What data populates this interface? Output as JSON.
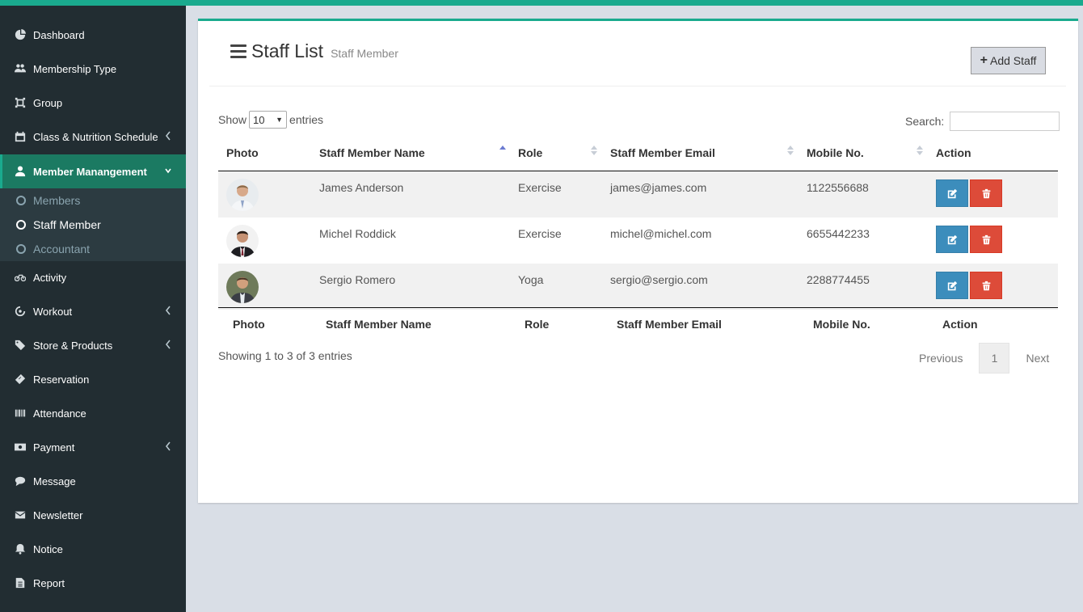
{
  "sidebar": {
    "items": [
      {
        "label": "Dashboard",
        "icon": "dashboard-icon"
      },
      {
        "label": "Membership Type",
        "icon": "users-icon"
      },
      {
        "label": "Group",
        "icon": "group-icon"
      },
      {
        "label": "Class & Nutrition Schedule",
        "icon": "calendar-icon"
      },
      {
        "label": "Member Manangement",
        "icon": "user-icon"
      },
      {
        "label": "Activity",
        "icon": "bicycle-icon"
      },
      {
        "label": "Workout",
        "icon": "dumbbell-icon"
      },
      {
        "label": "Store & Products",
        "icon": "tags-icon"
      },
      {
        "label": "Reservation",
        "icon": "ticket-icon"
      },
      {
        "label": "Attendance",
        "icon": "barcode-icon"
      },
      {
        "label": "Payment",
        "icon": "money-icon"
      },
      {
        "label": "Message",
        "icon": "comment-icon"
      },
      {
        "label": "Newsletter",
        "icon": "envelope-icon"
      },
      {
        "label": "Notice",
        "icon": "bell-icon"
      },
      {
        "label": "Report",
        "icon": "file-icon"
      }
    ],
    "submenu": [
      {
        "label": "Members"
      },
      {
        "label": "Staff Member"
      },
      {
        "label": "Accountant"
      }
    ]
  },
  "header": {
    "title": "Staff List",
    "subtitle": "Staff Member",
    "add_button": "Add Staff"
  },
  "controls": {
    "show_label": "Show",
    "entries_value": "10",
    "entries_label": "entries",
    "search_label": "Search:",
    "search_value": ""
  },
  "table": {
    "columns": [
      "Photo",
      "Staff Member Name",
      "Role",
      "Staff Member Email",
      "Mobile No.",
      "Action"
    ],
    "rows": [
      {
        "name": "James Anderson",
        "role": "Exercise",
        "email": "james@james.com",
        "mobile": "1122556688"
      },
      {
        "name": "Michel Roddick",
        "role": "Exercise",
        "email": "michel@michel.com",
        "mobile": "6655442233"
      },
      {
        "name": "Sergio Romero",
        "role": "Yoga",
        "email": "sergio@sergio.com",
        "mobile": "2288774455"
      }
    ]
  },
  "footer": {
    "info": "Showing 1 to 3 of 3 entries",
    "previous": "Previous",
    "page": "1",
    "next": "Next"
  }
}
